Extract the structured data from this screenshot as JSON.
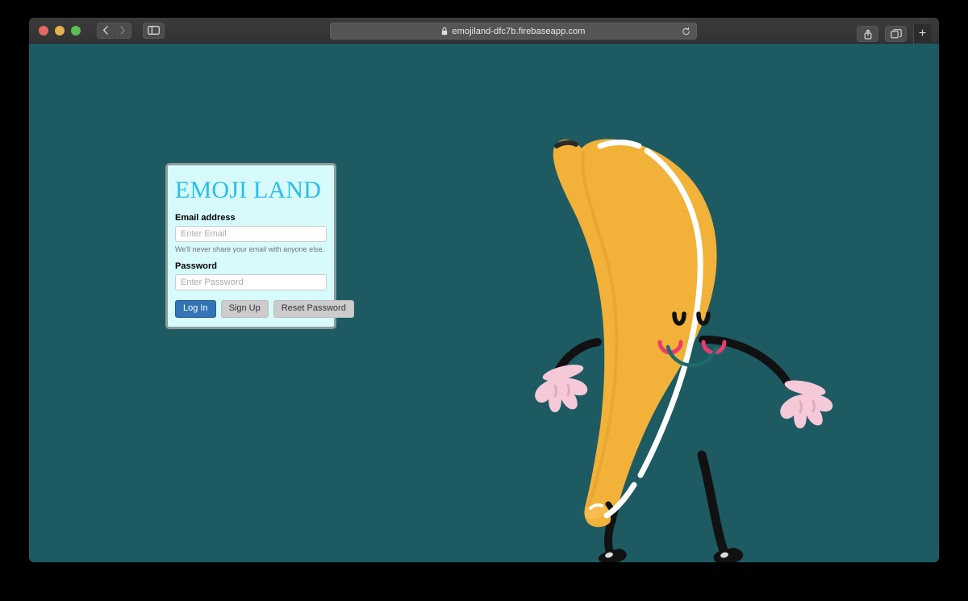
{
  "browser": {
    "traffic_lights": [
      "close",
      "minimize",
      "maximize"
    ],
    "back_label": "‹",
    "forward_label": "›",
    "sidebar_icon": "sidebar-icon",
    "url": "emojiland-dfc7b.firebaseapp.com",
    "lock_icon": "lock-icon",
    "reload_icon": "reload-icon",
    "share_icon": "share-icon",
    "tabs_icon": "tabs-icon",
    "new_tab_label": "+"
  },
  "page": {
    "background_color": "#1d5a62"
  },
  "card": {
    "title": "EMOJI LAND",
    "title_color": "#2bbdee",
    "background_color": "#d7fbfd",
    "border_color": "#8f9a9a",
    "email_label": "Email address",
    "email_placeholder": "Enter Email",
    "email_value": "",
    "email_help": "We'll never share your email with anyone else.",
    "password_label": "Password",
    "password_placeholder": "Enter Password",
    "password_value": "",
    "buttons": [
      {
        "label": "Log In",
        "style": "primary",
        "color": "#3274b5"
      },
      {
        "label": "Sign Up",
        "style": "default",
        "color": "#cccccc"
      },
      {
        "label": "Reset Password",
        "style": "default",
        "color": "#cccccc"
      }
    ]
  },
  "illustration": {
    "name": "dancing-banana",
    "body_color": "#f2b138",
    "highlight_color": "#ffffff",
    "limb_color": "#111111",
    "glove_color": "#f6c9d9",
    "blush_color": "#ec3b6e",
    "mouth_color": "#1f6b6b",
    "eye_color": "#111111"
  }
}
